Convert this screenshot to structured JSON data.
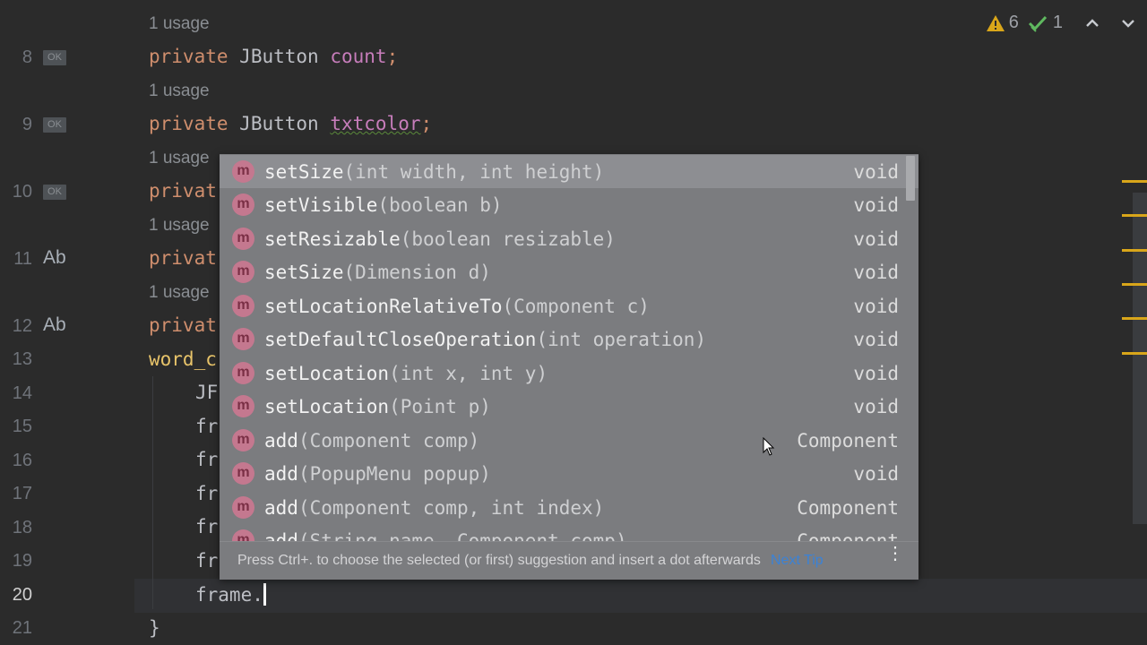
{
  "gutter": {
    "lines": [
      {
        "num": "8",
        "badge": "OK"
      },
      {
        "num": "9",
        "badge": "OK"
      },
      {
        "num": "10",
        "badge": "OK"
      },
      {
        "num": "11",
        "badge": "Ab"
      },
      {
        "num": "12",
        "badge": "Ab"
      },
      {
        "num": "13"
      },
      {
        "num": "14"
      },
      {
        "num": "15"
      },
      {
        "num": "16"
      },
      {
        "num": "17"
      },
      {
        "num": "18"
      },
      {
        "num": "19"
      },
      {
        "num": "20"
      },
      {
        "num": "21"
      }
    ]
  },
  "usages": [
    "1 usage",
    "1 usage",
    "1 usage",
    "1 usage",
    "1 usage"
  ],
  "code": {
    "line8": {
      "kw": "private",
      "type": "JButton",
      "field": "count",
      "semi": ";"
    },
    "line9": {
      "kw": "private",
      "type": "JButton",
      "field": "txtcolor",
      "semi": ";"
    },
    "line10": "privat",
    "line11": "privat",
    "line12": "privat",
    "line13": "word_c",
    "line14": "JF",
    "line15": "fr",
    "line16": "fr",
    "line17": "fr",
    "line18": "fr",
    "line19": "fr",
    "line20": "frame.",
    "line21": "}"
  },
  "indicators": {
    "warnings": "6",
    "checks": "1",
    "up_icon": "chevron-up-icon",
    "down_icon": "chevron-down-icon"
  },
  "completion": {
    "icon_letter": "m",
    "items": [
      {
        "name": "setSize",
        "params": "(int width, int height)",
        "ret": "void"
      },
      {
        "name": "setVisible",
        "params": "(boolean b)",
        "ret": "void"
      },
      {
        "name": "setResizable",
        "params": "(boolean resizable)",
        "ret": "void"
      },
      {
        "name": "setSize",
        "params": "(Dimension d)",
        "ret": "void"
      },
      {
        "name": "setLocationRelativeTo",
        "params": "(Component c)",
        "ret": "void"
      },
      {
        "name": "setDefaultCloseOperation",
        "params": "(int operation)",
        "ret": "void"
      },
      {
        "name": "setLocation",
        "params": "(int x, int y)",
        "ret": "void"
      },
      {
        "name": "setLocation",
        "params": "(Point p)",
        "ret": "void"
      },
      {
        "name": "add",
        "params": "(Component comp)",
        "ret": "Component"
      },
      {
        "name": "add",
        "params": "(PopupMenu popup)",
        "ret": "void"
      },
      {
        "name": "add",
        "params": "(Component comp, int index)",
        "ret": "Component"
      },
      {
        "name": "add",
        "params": "(String name, Component comp)",
        "ret": "Component"
      }
    ],
    "footer_hint": "Press Ctrl+. to choose the selected (or first) suggestion and insert a dot afterwards",
    "next_tip": "Next Tip"
  },
  "colors": {
    "editor_bg": "#2b2b2b",
    "keyword": "#cf8e6d",
    "field": "#c77dbb",
    "popup_bg": "#7b7c7f",
    "method_icon": "#c4788f",
    "link": "#3b82d6",
    "warning": "#d9a61a"
  }
}
